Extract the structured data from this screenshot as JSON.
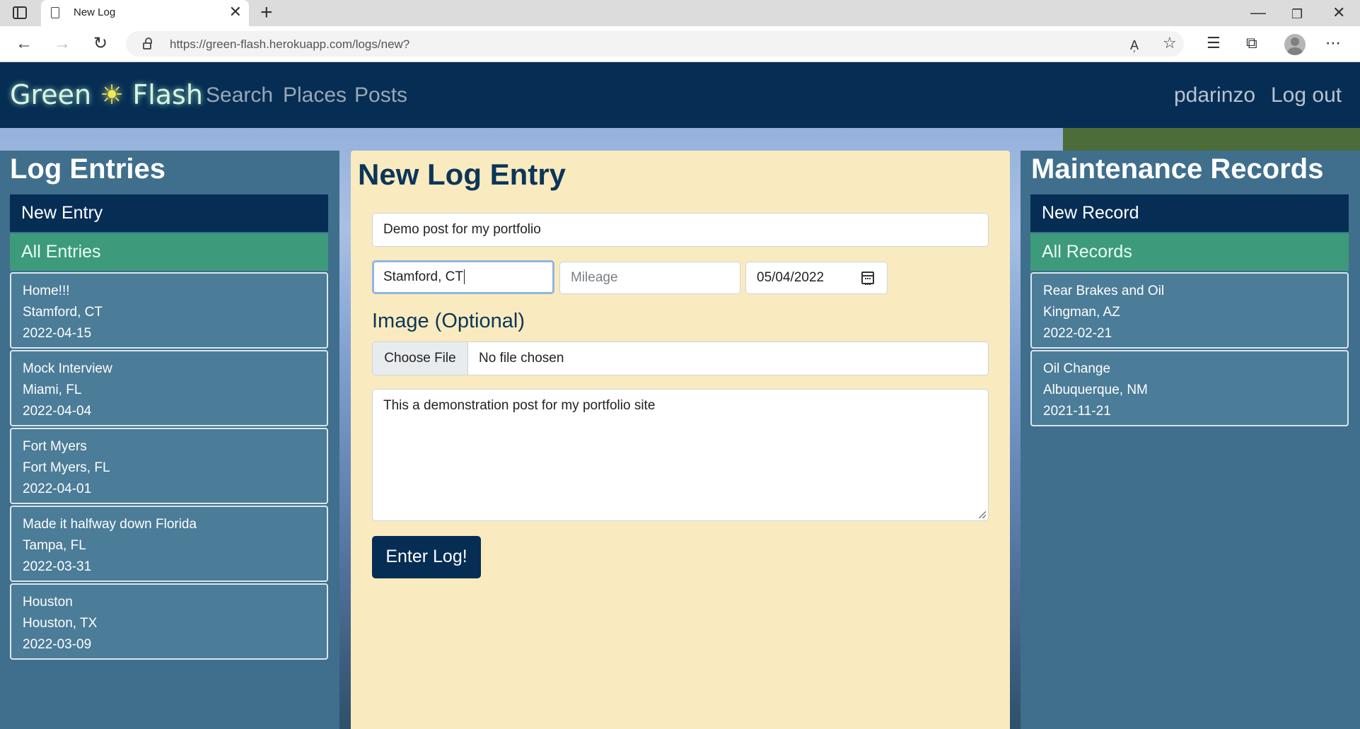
{
  "browser": {
    "tab_title": "New Log",
    "url": "https://green-flash.herokuapp.com/logs/new?"
  },
  "navbar": {
    "brand_left": "Green",
    "brand_icon": "☀",
    "brand_right": "Flash",
    "links": [
      "Search",
      "Places",
      "Posts"
    ],
    "user": "pdarinzo",
    "logout": "Log out"
  },
  "log_sidebar": {
    "title": "Log Entries",
    "new_label": "New Entry",
    "all_label": "All Entries",
    "entries": [
      {
        "title": "Home!!!",
        "place": "Stamford, CT",
        "date": "2022-04-15"
      },
      {
        "title": "Mock Interview",
        "place": "Miami, FL",
        "date": "2022-04-04"
      },
      {
        "title": "Fort Myers",
        "place": "Fort Myers, FL",
        "date": "2022-04-01"
      },
      {
        "title": "Made it halfway down Florida",
        "place": "Tampa, FL",
        "date": "2022-03-31"
      },
      {
        "title": "Houston",
        "place": "Houston, TX",
        "date": "2022-03-09"
      }
    ]
  },
  "form": {
    "heading": "New Log Entry",
    "title_value": "Demo post for my portfolio",
    "location_value": "Stamford, CT",
    "mileage_placeholder": "Mileage",
    "date_value": "05/04/2022",
    "image_label": "Image (Optional)",
    "choose_file": "Choose File",
    "file_status": "No file chosen",
    "body_value": "This a demonstration post for my portfolio site",
    "submit": "Enter Log!"
  },
  "maintenance_sidebar": {
    "title": "Maintenance Records",
    "new_label": "New Record",
    "all_label": "All Records",
    "records": [
      {
        "title": "Rear Brakes and Oil",
        "place": "Kingman, AZ",
        "date": "2022-02-21"
      },
      {
        "title": "Oil Change",
        "place": "Albuquerque, NM",
        "date": "2021-11-21"
      }
    ]
  }
}
